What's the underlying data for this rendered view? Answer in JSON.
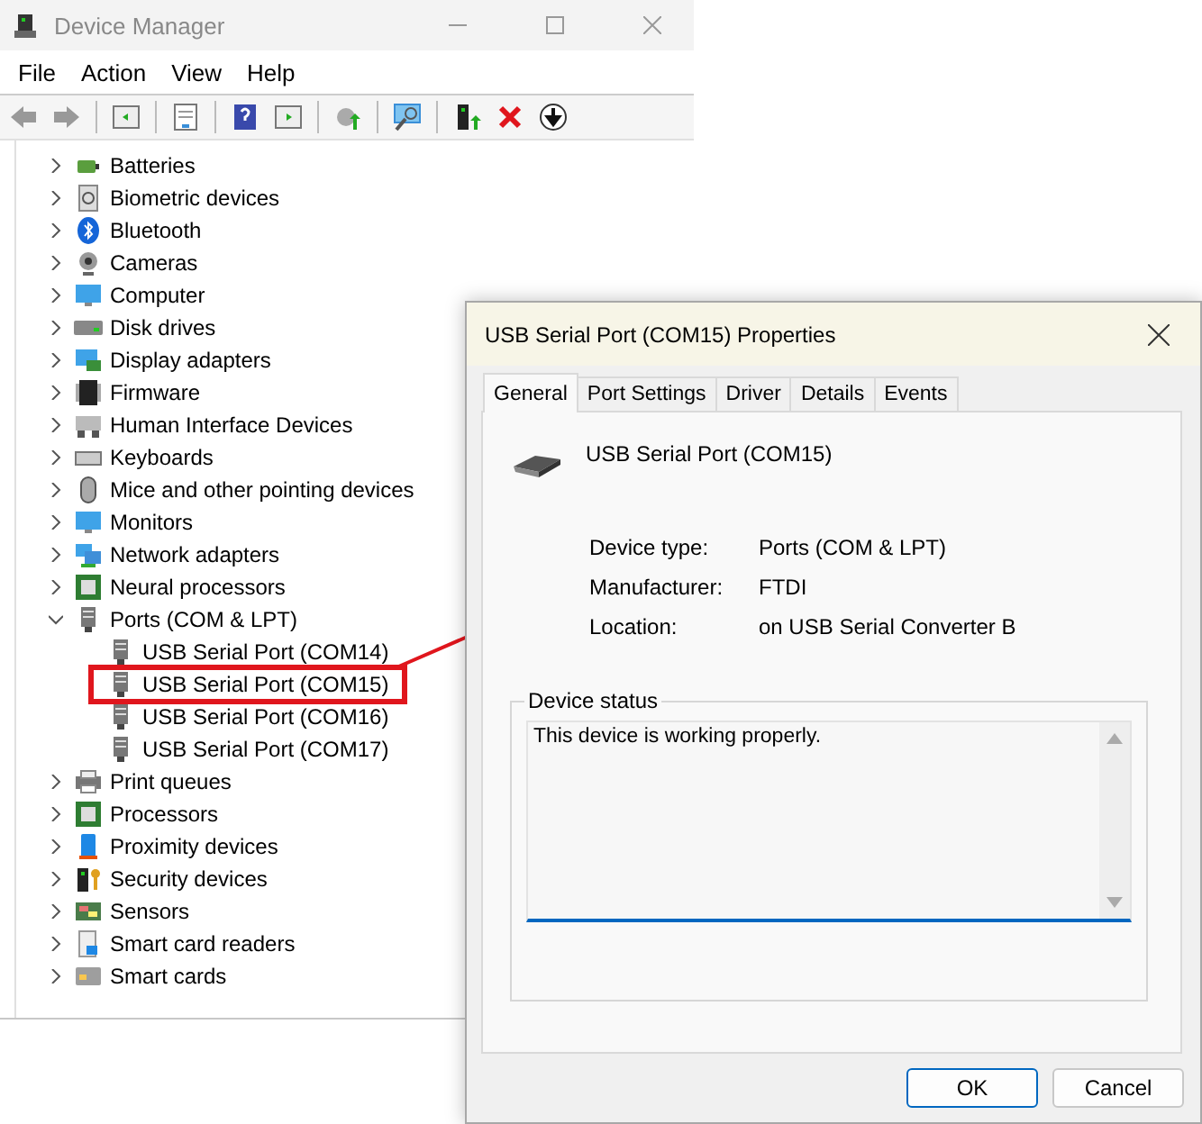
{
  "window": {
    "title": "Device Manager"
  },
  "menu": [
    "File",
    "Action",
    "View",
    "Help"
  ],
  "tree": [
    {
      "label": "Batteries",
      "expanded": false
    },
    {
      "label": "Biometric devices",
      "expanded": false
    },
    {
      "label": "Bluetooth",
      "expanded": false
    },
    {
      "label": "Cameras",
      "expanded": false
    },
    {
      "label": "Computer",
      "expanded": false
    },
    {
      "label": "Disk drives",
      "expanded": false
    },
    {
      "label": "Display adapters",
      "expanded": false
    },
    {
      "label": "Firmware",
      "expanded": false
    },
    {
      "label": "Human Interface Devices",
      "expanded": false
    },
    {
      "label": "Keyboards",
      "expanded": false
    },
    {
      "label": "Mice and other pointing devices",
      "expanded": false
    },
    {
      "label": "Monitors",
      "expanded": false
    },
    {
      "label": "Network adapters",
      "expanded": false
    },
    {
      "label": "Neural processors",
      "expanded": false
    },
    {
      "label": "Ports (COM & LPT)",
      "expanded": true,
      "children": [
        {
          "label": "USB Serial Port (COM14)",
          "highlighted": false
        },
        {
          "label": "USB Serial Port (COM15)",
          "highlighted": true
        },
        {
          "label": "USB Serial Port (COM16)",
          "highlighted": false
        },
        {
          "label": "USB Serial Port (COM17)",
          "highlighted": false
        }
      ]
    },
    {
      "label": "Print queues",
      "expanded": false
    },
    {
      "label": "Processors",
      "expanded": false
    },
    {
      "label": "Proximity devices",
      "expanded": false
    },
    {
      "label": "Security devices",
      "expanded": false
    },
    {
      "label": "Sensors",
      "expanded": false
    },
    {
      "label": "Smart card readers",
      "expanded": false
    },
    {
      "label": "Smart cards",
      "expanded": false
    }
  ],
  "dialog": {
    "title": "USB Serial Port (COM15) Properties",
    "tabs": [
      {
        "label": "General",
        "selected": true
      },
      {
        "label": "Port Settings",
        "selected": false
      },
      {
        "label": "Driver",
        "selected": false
      },
      {
        "label": "Details",
        "selected": false
      },
      {
        "label": "Events",
        "selected": false
      }
    ],
    "device_name": "USB Serial Port (COM15)",
    "properties": [
      {
        "label": "Device type:",
        "value": "Ports (COM & LPT)"
      },
      {
        "label": "Manufacturer:",
        "value": "FTDI"
      },
      {
        "label": "Location:",
        "value": "on USB Serial Converter B"
      }
    ],
    "status_group": {
      "title": "Device status",
      "text": "This device is working properly."
    },
    "buttons": [
      {
        "label": "OK",
        "default": true
      },
      {
        "label": "Cancel",
        "default": false
      }
    ]
  }
}
